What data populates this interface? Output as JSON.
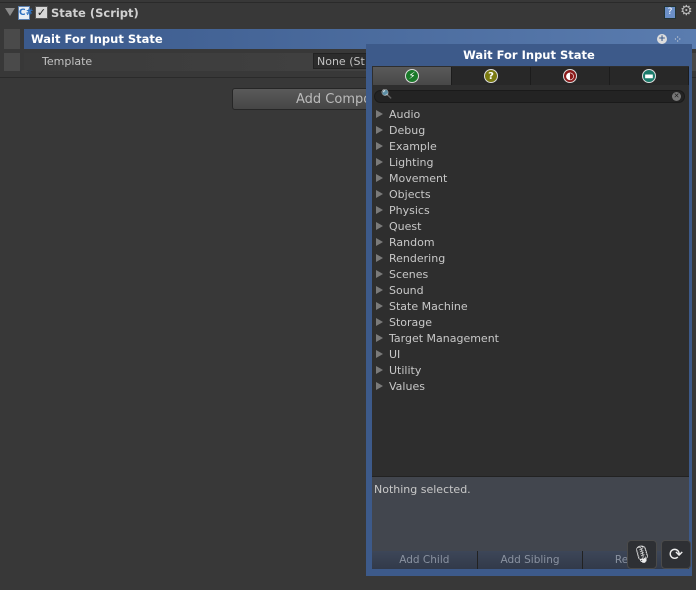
{
  "component": {
    "title": "State (Script)",
    "enabled": true,
    "icons": [
      "csharp-script-icon",
      "help-icon",
      "gear-icon"
    ]
  },
  "state": {
    "title": "Wait For Input State",
    "template_label": "Template",
    "template_value": "None (St"
  },
  "add_component": "Add Compo",
  "popup": {
    "title": "Wait For Input State",
    "tabs": [
      {
        "icon": "lightning-icon",
        "glyph": "⚡",
        "color": "#1a7a2a"
      },
      {
        "icon": "question-icon",
        "glyph": "?",
        "color": "#7a7a10"
      },
      {
        "icon": "contrast-icon",
        "glyph": "◐",
        "color": "#8a1a1a"
      },
      {
        "icon": "folder-icon",
        "glyph": "▬",
        "color": "#1a7a6a"
      }
    ],
    "search_value": "",
    "categories": [
      "Audio",
      "Debug",
      "Example",
      "Lighting",
      "Movement",
      "Objects",
      "Physics",
      "Quest",
      "Random",
      "Rendering",
      "Scenes",
      "Sound",
      "State Machine",
      "Storage",
      "Target Management",
      "UI",
      "Utility",
      "Values"
    ],
    "description": "Nothing selected.",
    "buttons": [
      "Add Child",
      "Add Sibling",
      "Replace"
    ]
  },
  "overlay_buttons": [
    {
      "icon": "microphone-icon",
      "glyph": "🎙"
    },
    {
      "icon": "refresh-icon",
      "glyph": "⟳"
    }
  ]
}
